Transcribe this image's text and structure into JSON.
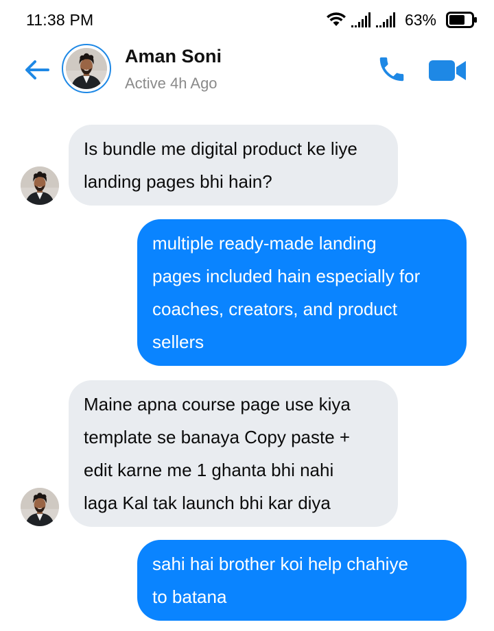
{
  "status_bar": {
    "time": "11:38 PM",
    "battery": "63%",
    "icons": [
      "wifi-icon",
      "signal-icon",
      "signal-icon",
      "battery-icon"
    ]
  },
  "header": {
    "name": "Aman Soni",
    "status": "Active 4h Ago",
    "icons": [
      "back-arrow-icon",
      "avatar",
      "phone-icon",
      "video-camera-icon"
    ]
  },
  "colors": {
    "accent": "#1e88e5",
    "outgoing_bubble": "#0a84ff",
    "incoming_bubble": "#e9ecf0",
    "muted_text": "#8a8a8a"
  },
  "messages": [
    {
      "direction": "incoming",
      "lines": [
        "Is bundle me digital product ke liye",
        "landing pages bhi hain?"
      ]
    },
    {
      "direction": "outgoing",
      "lines": [
        "multiple ready-made landing",
        "pages included hain especially for",
        "coaches, creators, and product",
        "sellers"
      ]
    },
    {
      "direction": "incoming",
      "lines": [
        "Maine apna course page use kiya",
        "template se banaya Copy paste +",
        "edit karne me 1 ghanta bhi nahi",
        "laga  Kal tak launch bhi kar diya"
      ]
    },
    {
      "direction": "outgoing",
      "lines": [
        "sahi hai brother koi help chahiye",
        "to batana"
      ]
    }
  ]
}
